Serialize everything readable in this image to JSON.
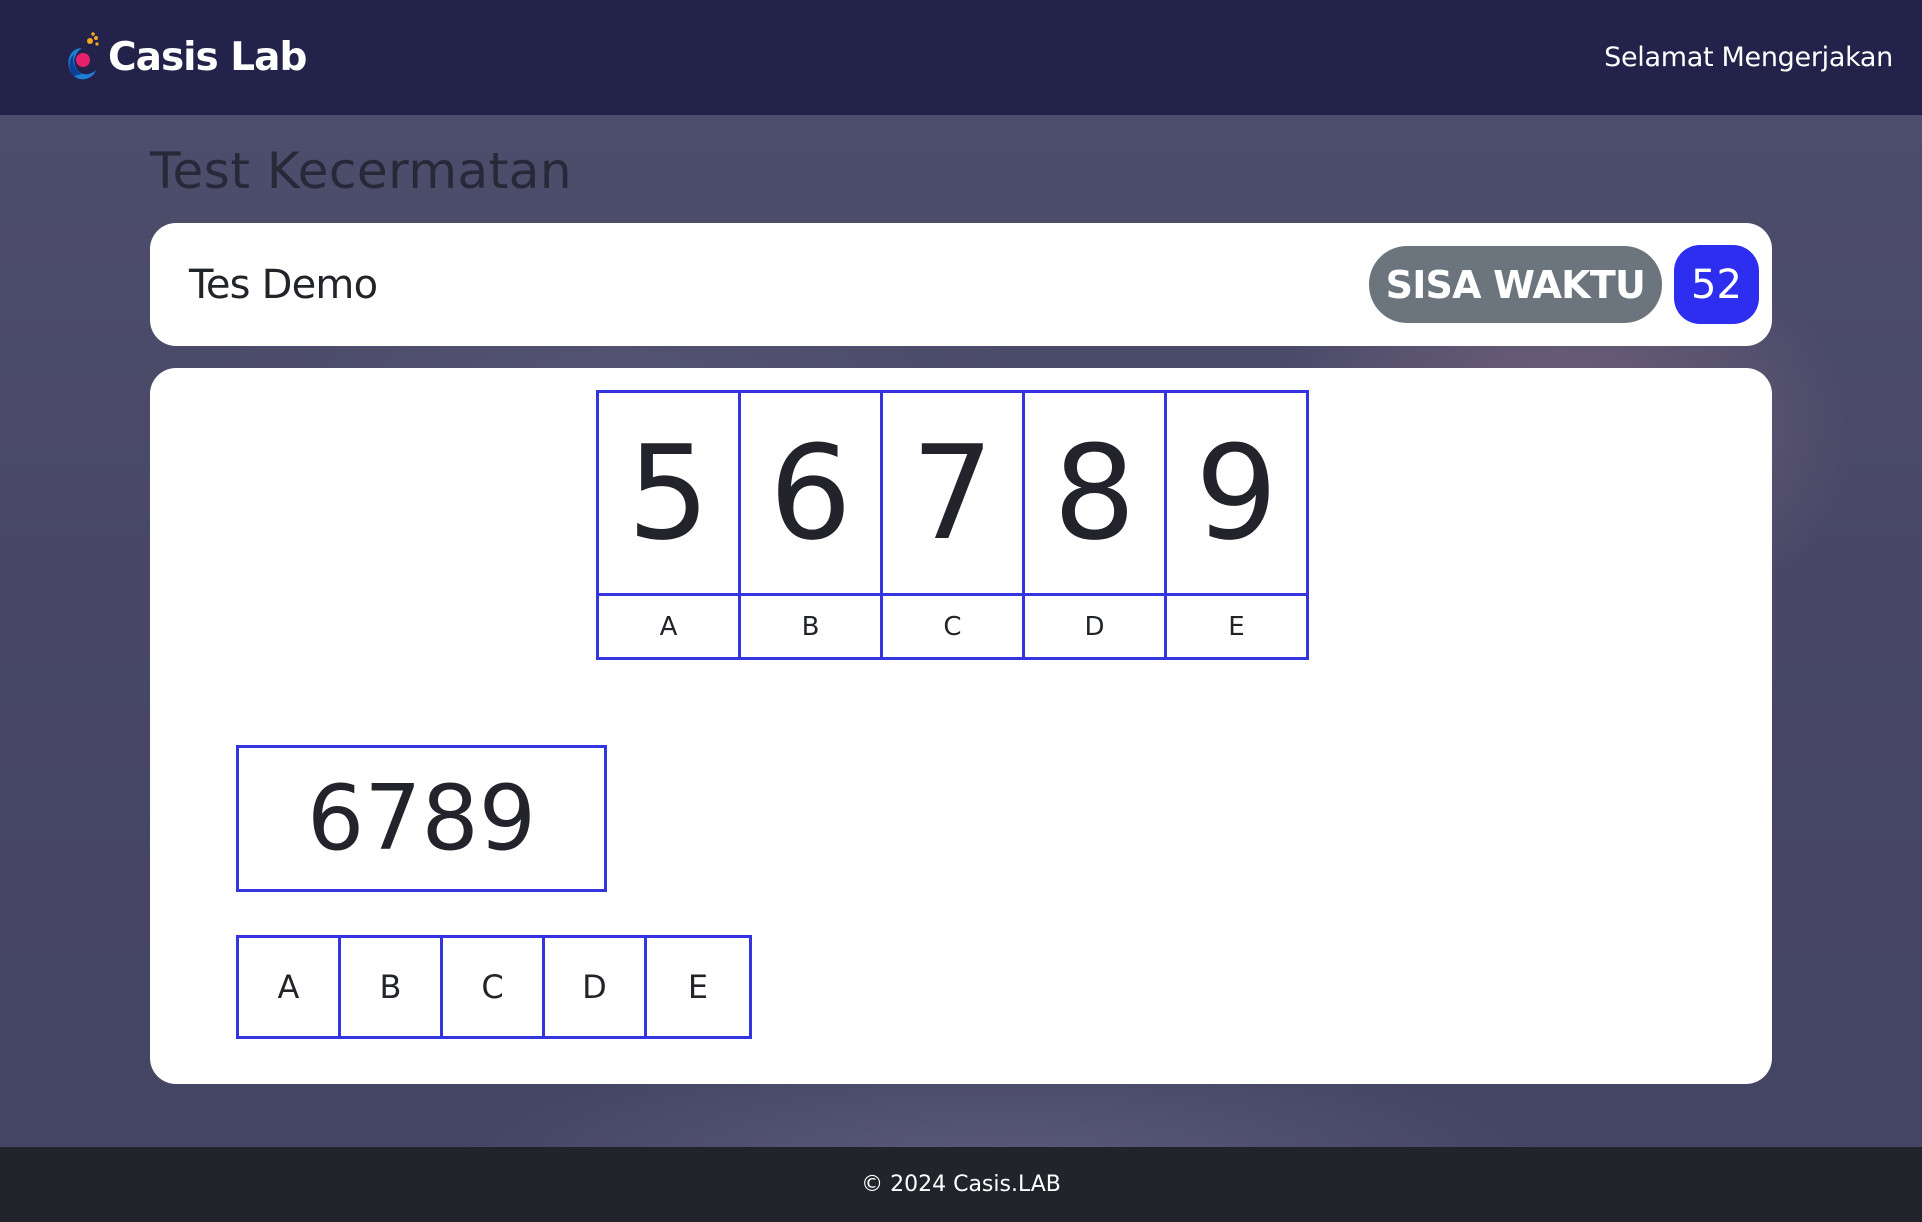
{
  "header": {
    "brand": "Casis Lab",
    "greeting": "Selamat Mengerjakan"
  },
  "page": {
    "title": "Test Kecermatan"
  },
  "test": {
    "name": "Tes Demo",
    "timer_label": "SISA WAKTU",
    "timer_value": "52"
  },
  "key_table": {
    "columns": [
      {
        "number": "5",
        "letter": "A"
      },
      {
        "number": "6",
        "letter": "B"
      },
      {
        "number": "7",
        "letter": "C"
      },
      {
        "number": "8",
        "letter": "D"
      },
      {
        "number": "9",
        "letter": "E"
      }
    ]
  },
  "question": {
    "text": "6789"
  },
  "answers": [
    "A",
    "B",
    "C",
    "D",
    "E"
  ],
  "footer": {
    "copyright": "© 2024 Casis.LAB"
  },
  "colors": {
    "navbar": "#23224a",
    "accent_blue": "#2e2ef0",
    "border_blue": "#3434e0",
    "timer_grey": "#6c757d",
    "footer": "#22242b"
  }
}
